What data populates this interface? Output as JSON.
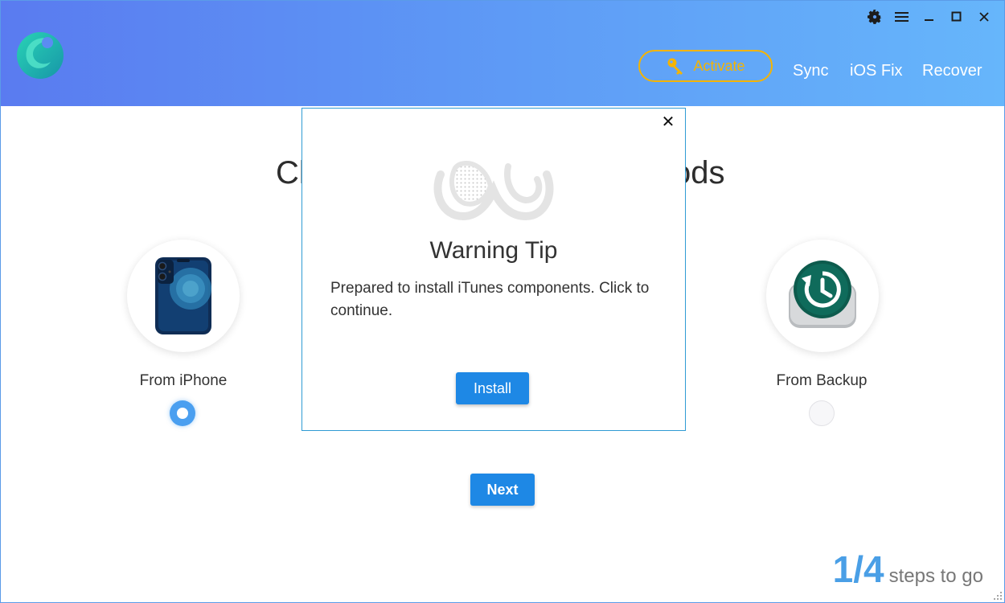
{
  "header": {
    "activate_label": "Activate",
    "nav": [
      "Sync",
      "iOS Fix",
      "Recover"
    ]
  },
  "main": {
    "title_left": "Cl",
    "title_right": "ods",
    "options": [
      {
        "label": "From iPhone",
        "selected": true
      },
      {
        "label": "From Backup",
        "selected": false
      }
    ],
    "next_label": "Next"
  },
  "steps": {
    "number": "1/4",
    "text": "steps to go"
  },
  "dialog": {
    "title": "Warning Tip",
    "message": "Prepared to install iTunes components. Click to continue.",
    "install_label": "Install",
    "close_glyph": "✕"
  },
  "icons": {
    "window": [
      "gear-icon",
      "menu-icon",
      "minimize-icon",
      "maximize-icon",
      "close-icon"
    ],
    "activate": "key-icon"
  },
  "colors": {
    "accent": "#1e88e5",
    "activate": "#f5b400",
    "steps": "#4a9fe6"
  }
}
